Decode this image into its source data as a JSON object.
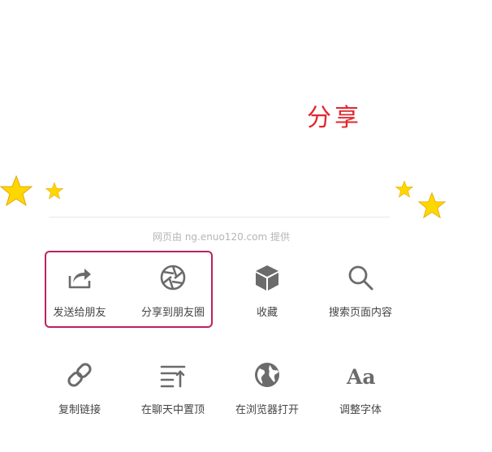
{
  "title": "分享",
  "provider": "网页由 ng.enuo120.com 提供",
  "menu": {
    "row1": [
      {
        "label": "发送给朋友",
        "icon": "forward-icon"
      },
      {
        "label": "分享到朋友圈",
        "icon": "moments-icon"
      },
      {
        "label": "收藏",
        "icon": "favorite-cube-icon"
      },
      {
        "label": "搜索页面内容",
        "icon": "search-icon"
      }
    ],
    "row2": [
      {
        "label": "复制链接",
        "icon": "link-icon"
      },
      {
        "label": "在聊天中置顶",
        "icon": "pin-top-icon"
      },
      {
        "label": "在浏览器打开",
        "icon": "globe-icon"
      },
      {
        "label": "调整字体",
        "icon": "font-size-icon"
      }
    ]
  },
  "colors": {
    "title": "#e0282e",
    "highlight_border": "#b8255f",
    "icon": "#6b6b6b",
    "star": "#ffd700"
  }
}
